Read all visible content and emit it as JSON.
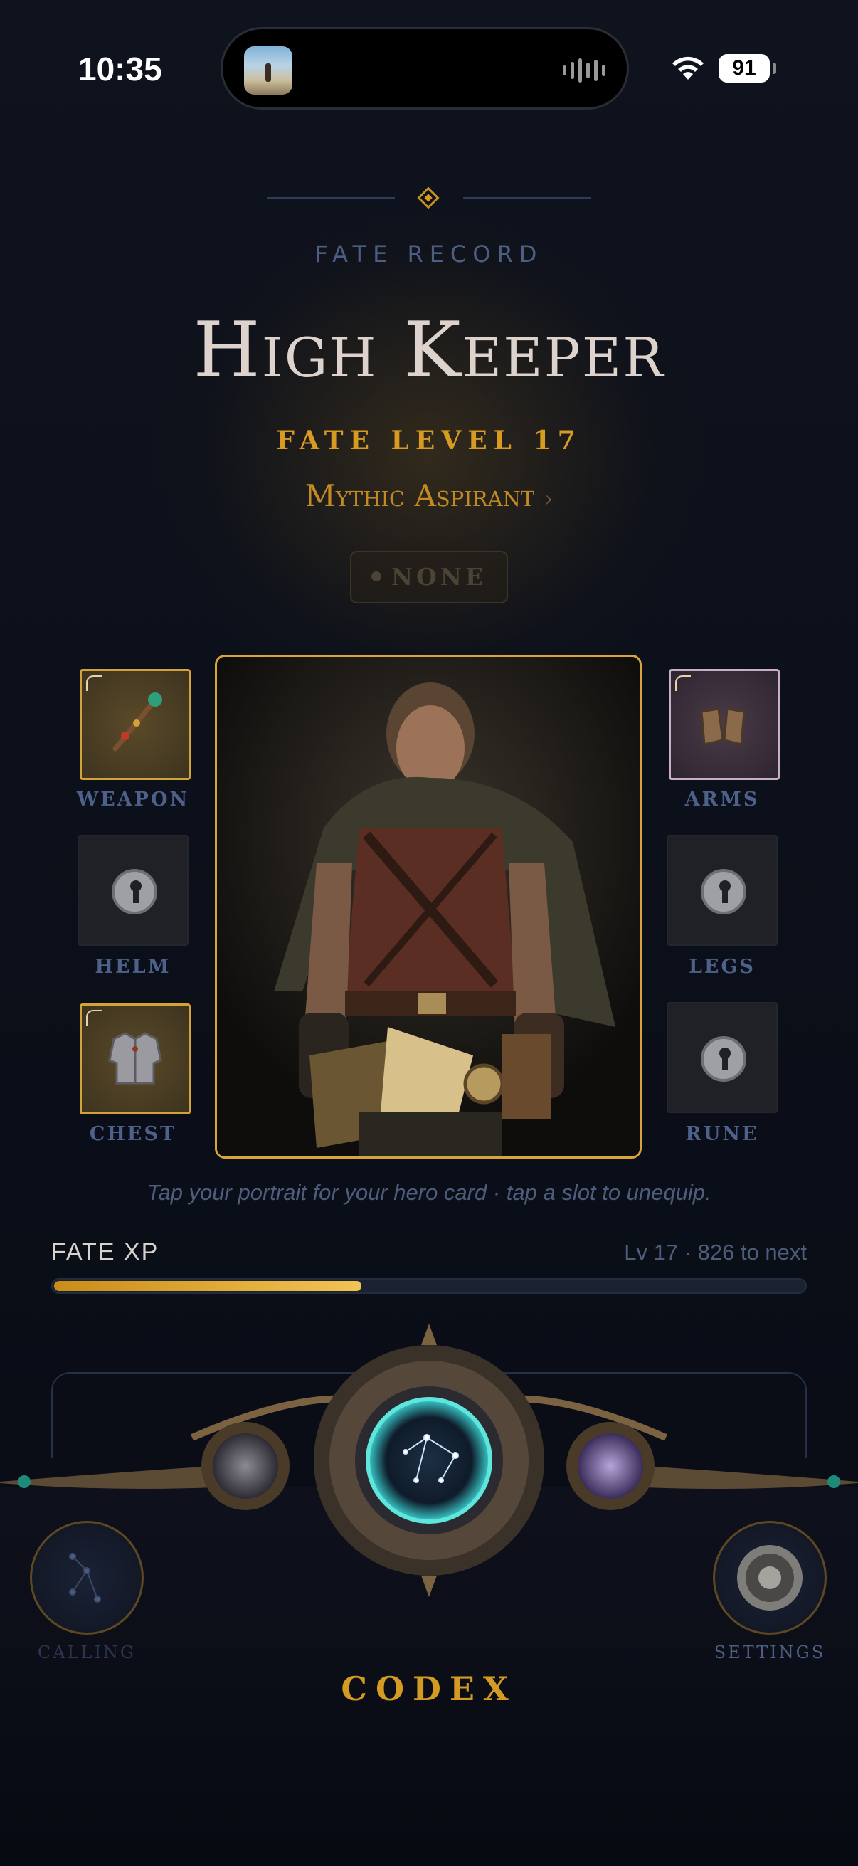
{
  "status_bar": {
    "time": "10:35",
    "battery": "91"
  },
  "header": {
    "eyebrow": "FATE RECORD",
    "title": "High Keeper",
    "level": "FATE LEVEL 17",
    "rank": "Mythic Aspirant",
    "rank_chevron": "›",
    "status_badge": "NONE"
  },
  "slots": {
    "weapon": {
      "label": "WEAPON",
      "state": "equipped",
      "icon": "wand-icon"
    },
    "helm": {
      "label": "HELM",
      "state": "empty",
      "icon": "keyhole-lock-icon"
    },
    "chest": {
      "label": "CHEST",
      "state": "equipped",
      "icon": "chest-armor-icon"
    },
    "arms": {
      "label": "ARMS",
      "state": "equipped",
      "icon": "gauntlets-icon"
    },
    "legs": {
      "label": "LEGS",
      "state": "empty",
      "icon": "keyhole-lock-icon"
    },
    "rune": {
      "label": "RUNE",
      "state": "empty",
      "icon": "keyhole-lock-icon"
    }
  },
  "hint": "Tap your portrait for your hero card · tap a slot to unequip.",
  "xp": {
    "label": "FATE XP",
    "meta": "Lv 17 · 826 to next",
    "progress": 0.41
  },
  "nav": {
    "left_label": "CALLING",
    "right_label": "SETTINGS",
    "center_label": "CODEX"
  },
  "colors": {
    "background": "#0b0f1a",
    "gold": "#d89b22",
    "muted_blue": "#4c5f82",
    "title": "#ddd3cc"
  }
}
